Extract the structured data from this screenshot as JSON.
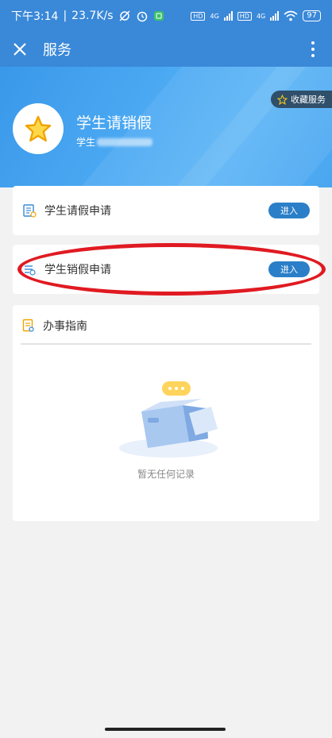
{
  "status_bar": {
    "time": "下午3:14",
    "net_speed": "23.7K/s",
    "battery": "97",
    "sim1": "4G",
    "sim2": "4G",
    "hd": "HD"
  },
  "app_bar": {
    "title": "服务"
  },
  "header": {
    "service_name": "学生请销假",
    "service_sub": "学生",
    "favorite_label": "收藏服务"
  },
  "items": [
    {
      "label": "学生请假申请",
      "button": "进入"
    },
    {
      "label": "学生销假申请",
      "button": "进入"
    }
  ],
  "guide": {
    "title": "办事指南",
    "empty_text": "暂无任何记录"
  },
  "colors": {
    "primary": "#3a88d8",
    "button": "#2b7fc8",
    "highlight": "#e01a22"
  }
}
